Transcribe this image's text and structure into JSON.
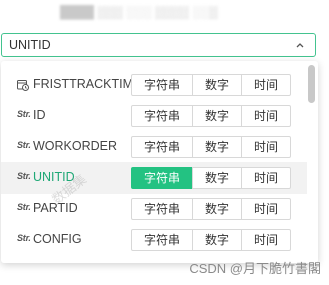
{
  "header": {
    "blurred_title": "████ ▒▒▒ ░░░ ▒▒▒▒ ░░▒"
  },
  "select": {
    "value": "UNITID",
    "arrow_icon": "chevron-up-icon"
  },
  "dropdown": {
    "rows": [
      {
        "icon": "calendar-clock-icon",
        "label": "FRISTTRACKTIME",
        "active": false,
        "selected_type": ""
      },
      {
        "icon": "string-type-icon",
        "icon_text": "Str.",
        "label": "ID",
        "active": false,
        "selected_type": ""
      },
      {
        "icon": "string-type-icon",
        "icon_text": "Str.",
        "label": "WORKORDER",
        "active": false,
        "selected_type": ""
      },
      {
        "icon": "string-type-icon",
        "icon_text": "Str.",
        "label": "UNITID",
        "active": true,
        "selected_type": "字符串"
      },
      {
        "icon": "string-type-icon",
        "icon_text": "Str.",
        "label": "PARTID",
        "active": false,
        "selected_type": ""
      },
      {
        "icon": "string-type-icon",
        "icon_text": "Str.",
        "label": "CONFIG",
        "active": false,
        "selected_type": ""
      }
    ],
    "type_options": [
      "字符串",
      "数字",
      "时间"
    ]
  },
  "watermark": {
    "stamp": "数据集",
    "text": "CSDN @月下脆竹書閣"
  },
  "colors": {
    "accent": "#23c282",
    "border_focus": "#43c38f",
    "active_row_bg": "#f2f2f2"
  }
}
